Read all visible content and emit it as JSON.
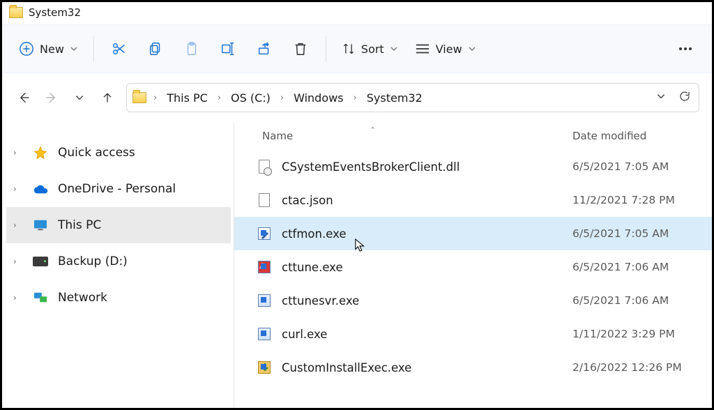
{
  "window": {
    "title": "System32"
  },
  "toolbar": {
    "new_label": "New",
    "sort_label": "Sort",
    "view_label": "View"
  },
  "breadcrumbs": [
    "This PC",
    "OS (C:)",
    "Windows",
    "System32"
  ],
  "sidebar": {
    "items": [
      {
        "label": "Quick access"
      },
      {
        "label": "OneDrive - Personal"
      },
      {
        "label": "This PC"
      },
      {
        "label": "Backup (D:)"
      },
      {
        "label": "Network"
      }
    ]
  },
  "columns": {
    "name": "Name",
    "date": "Date modified"
  },
  "files": [
    {
      "name": "CSystemEventsBrokerClient.dll",
      "date": "6/5/2021 7:05 AM"
    },
    {
      "name": "ctac.json",
      "date": "11/2/2021 7:28 PM"
    },
    {
      "name": "ctfmon.exe",
      "date": "6/5/2021 7:05 AM"
    },
    {
      "name": "cttune.exe",
      "date": "6/5/2021 7:06 AM"
    },
    {
      "name": "cttunesvr.exe",
      "date": "6/5/2021 7:06 AM"
    },
    {
      "name": "curl.exe",
      "date": "1/11/2022 3:29 PM"
    },
    {
      "name": "CustomInstallExec.exe",
      "date": "2/16/2022 12:26 PM"
    }
  ]
}
